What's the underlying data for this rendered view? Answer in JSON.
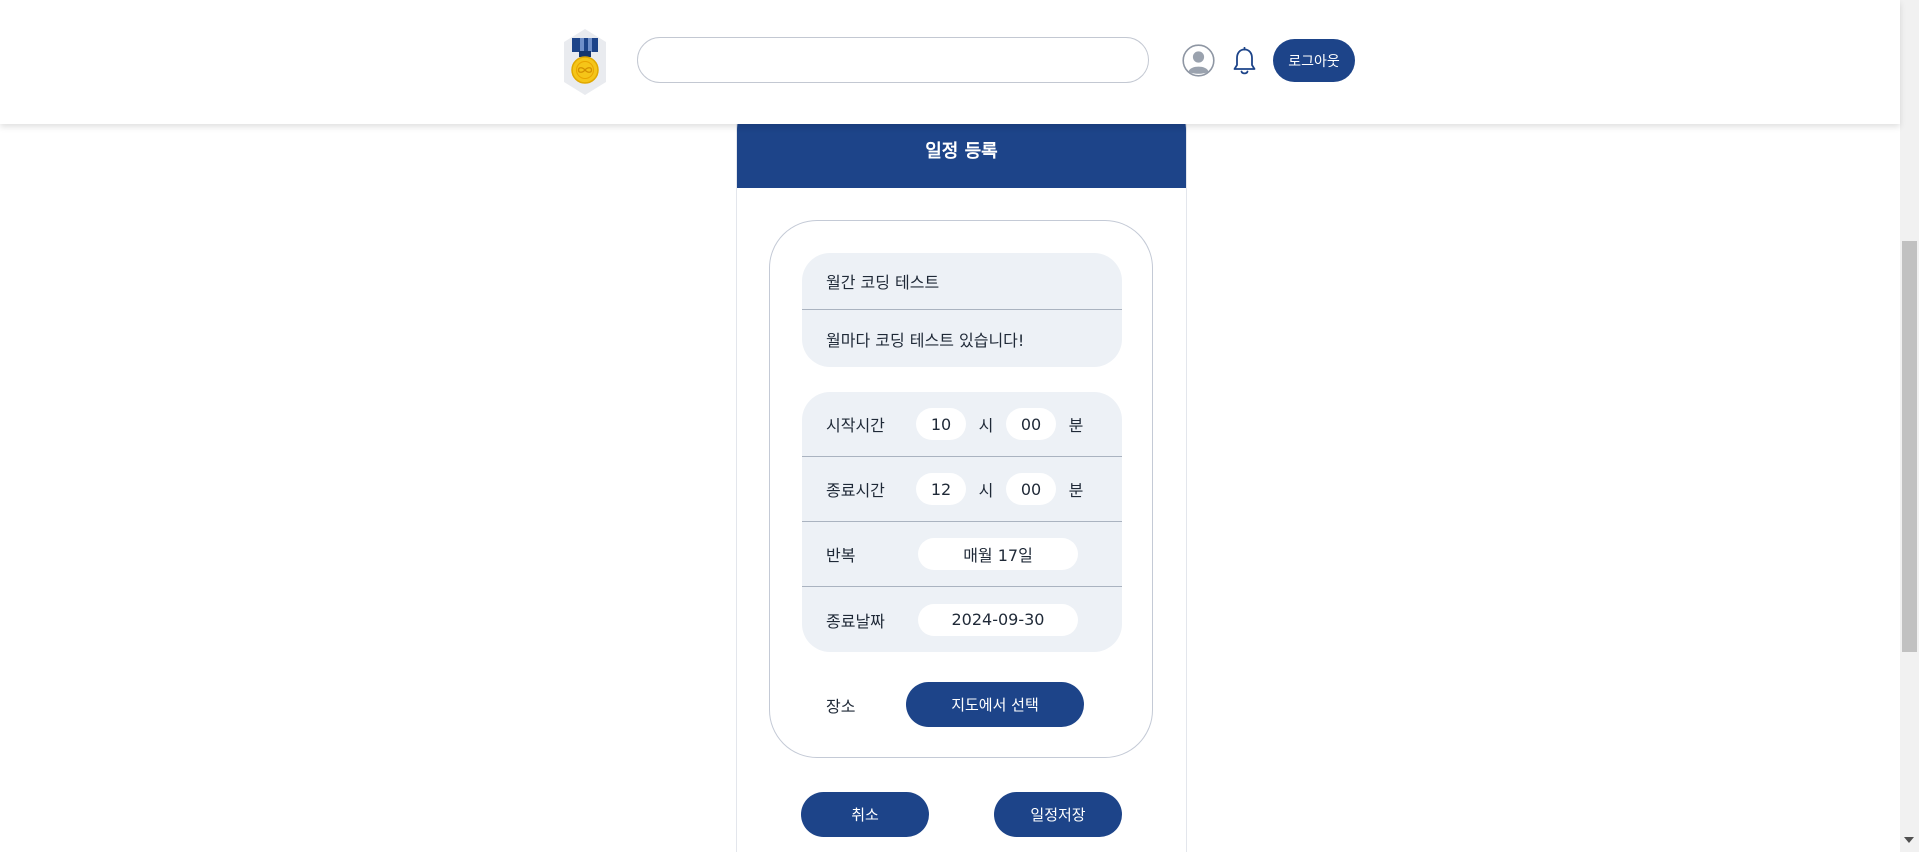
{
  "header": {
    "search_placeholder": "",
    "logout_label": "로그아웃"
  },
  "colors": {
    "primary": "#1d4489",
    "panel": "#edf1f6",
    "medal_gold": "#f5c518",
    "ribbon_blue": "#1d4489"
  },
  "icons": [
    "medal-logo",
    "user-icon",
    "bell-icon"
  ],
  "modal": {
    "title": "일정 등록",
    "schedule_title": "월간 코딩 테스트",
    "schedule_description": "월마다 코딩 테스트 있습니다!",
    "start_time": {
      "label": "시작시간",
      "hour": "10",
      "hour_unit": "시",
      "minute": "00",
      "minute_unit": "분"
    },
    "end_time": {
      "label": "종료시간",
      "hour": "12",
      "hour_unit": "시",
      "minute": "00",
      "minute_unit": "분"
    },
    "repeat": {
      "label": "반복",
      "value": "매월 17일"
    },
    "end_date": {
      "label": "종료날짜",
      "value": "2024-09-30"
    },
    "place": {
      "label": "장소",
      "button_label": "지도에서 선택"
    },
    "cancel_label": "취소",
    "save_label": "일정저장"
  }
}
